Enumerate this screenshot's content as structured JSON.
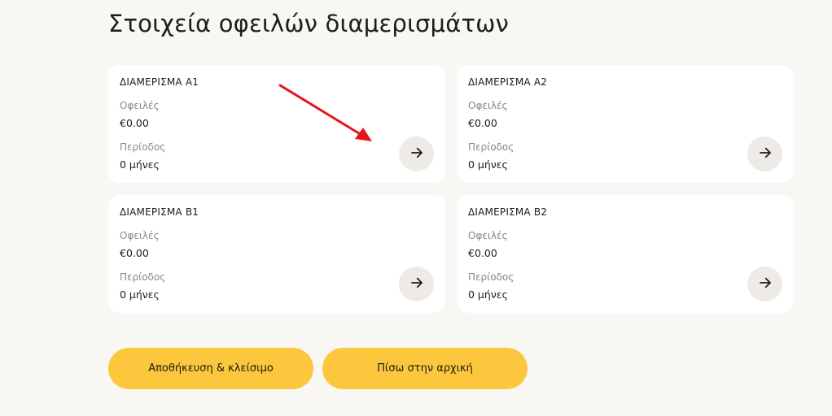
{
  "page": {
    "title": "Στοιχεία οφειλών διαμερισμάτων"
  },
  "apartments": [
    {
      "name": "ΔΙΑΜΕΡΙΣΜΑ Α1",
      "debts_label": "Οφειλές",
      "debts_value": "€0.00",
      "period_label": "Περίοδος",
      "period_value": "0 μήνες"
    },
    {
      "name": "ΔΙΑΜΕΡΙΣΜΑ Α2",
      "debts_label": "Οφειλές",
      "debts_value": "€0.00",
      "period_label": "Περίοδος",
      "period_value": "0 μήνες"
    },
    {
      "name": "ΔΙΑΜΕΡΙΣΜΑ Β1",
      "debts_label": "Οφειλές",
      "debts_value": "€0.00",
      "period_label": "Περίοδος",
      "period_value": "0 μήνες"
    },
    {
      "name": "ΔΙΑΜΕΡΙΣΜΑ Β2",
      "debts_label": "Οφειλές",
      "debts_value": "€0.00",
      "period_label": "Περίοδος",
      "period_value": "0 μήνες"
    }
  ],
  "card_action_icon": "arrow-right-icon",
  "annotation": {
    "icon": "red-arrow-annotation",
    "color": "#e8141c"
  },
  "actions": {
    "save_label": "Αποθήκευση & κλείσιμο",
    "back_label": "Πίσω στην αρχική"
  },
  "colors": {
    "background": "#f9f7f3",
    "card": "#ffffff",
    "accent": "#fcc73c",
    "icon_button": "#eeebe7",
    "muted_text": "#8a8580"
  }
}
